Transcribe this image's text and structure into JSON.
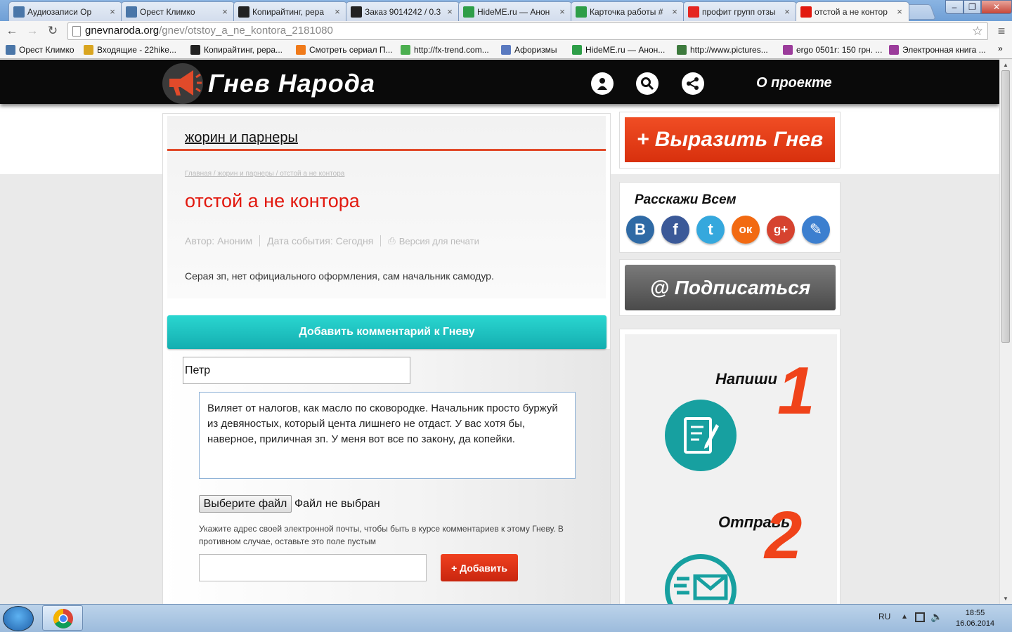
{
  "browser": {
    "tabs": [
      {
        "title": "Аудиозаписи Ор",
        "icon": "play-icon",
        "color": "#4a76a8"
      },
      {
        "title": "Орест Климко",
        "icon": "vk-icon",
        "color": "#4a76a8"
      },
      {
        "title": "Копирайтинг, рера",
        "icon": "a-icon",
        "color": "#222222"
      },
      {
        "title": "Заказ 9014242 / 0.3",
        "icon": "a-icon",
        "color": "#222222"
      },
      {
        "title": "HideME.ru — Анон",
        "icon": "h-icon",
        "color": "#2e9e48"
      },
      {
        "title": "Карточка работы #",
        "icon": "h-icon",
        "color": "#2e9e48"
      },
      {
        "title": "профит групп отзы",
        "icon": "yandex-icon",
        "color": "#e52620"
      },
      {
        "title": "отстой а не контор",
        "icon": "megaphone-icon",
        "color": "#e2190f",
        "active": true
      }
    ],
    "url_domain": "gnevnaroda.org",
    "url_path": "/gnev/otstoy_a_ne_kontora_2181080",
    "bookmarks": [
      {
        "label": "Орест Климко",
        "icon": "vk-icon",
        "color": "#4a76a8"
      },
      {
        "label": "Входящие - 22hike...",
        "icon": "mail-icon",
        "color": "#d9a520"
      },
      {
        "label": "Копирайтинг, рера...",
        "icon": "a-icon",
        "color": "#222222"
      },
      {
        "label": "Смотреть сериал П...",
        "icon": "f-icon",
        "color": "#f07a1a"
      },
      {
        "label": "http://fx-trend.com...",
        "icon": "fx-icon",
        "color": "#4caf50"
      },
      {
        "label": "Афоризмы",
        "icon": "diamond-icon",
        "color": "#5a7ac0"
      },
      {
        "label": "HideME.ru — Анон...",
        "icon": "h-icon",
        "color": "#2e9e48"
      },
      {
        "label": "http://www.pictures...",
        "icon": "picture-icon",
        "color": "#3d7a3d"
      },
      {
        "label": "ergo 0501r: 150 грн. ...",
        "icon": "ergo-icon",
        "color": "#9b3c9b"
      },
      {
        "label": "Электронная книга ...",
        "icon": "book-icon",
        "color": "#9b3c9b"
      }
    ]
  },
  "site": {
    "logo_text": "Гнев Народа",
    "about_label": "О проекте",
    "accent_color": "#e14a2a",
    "teal_color": "#17a0a0"
  },
  "article": {
    "category": "жорин и парнеры",
    "breadcrumb": [
      "Главная",
      "жорин и парнеры",
      "отстой а не контора"
    ],
    "title": "отстой а не контора",
    "author": "Автор: Аноним",
    "event_date": "Дата события: Сегодня",
    "print_label": "Версия для печати",
    "body": "Серая зп, нет официального оформления, сам начальник самодур."
  },
  "comment_form": {
    "header": "Добавить комментарий к Гневу",
    "name_value": "Петр",
    "comment_value": "Виляет от налогов, как масло по сковородке. Начальник просто буржуй из девяностых, который цента лишнего не отдаст. У вас хотя бы, наверное, приличная зп. У меня вот все по закону, да копейки.",
    "file_button": "Выберите файл",
    "file_status": "Файл не выбран",
    "email_hint": "Укажите адрес своей электронной почты, чтобы быть в курсе комментариев к этому Гневу. В противном случае, оставьте это поле пустым",
    "email_value": "",
    "submit_label": "+ Добавить"
  },
  "sidebar": {
    "express_button": "+ Выразить Гнев",
    "share_title": "Расскажи Всем",
    "social": [
      {
        "name": "vk",
        "glyph": "В",
        "color": "#2f6aa5"
      },
      {
        "name": "facebook",
        "glyph": "f",
        "color": "#3b5998"
      },
      {
        "name": "twitter",
        "glyph": "t",
        "color": "#35a8dd"
      },
      {
        "name": "odnoklassniki",
        "glyph": "ок",
        "color": "#f26a12"
      },
      {
        "name": "google-plus",
        "glyph": "g+",
        "color": "#d6432f"
      },
      {
        "name": "livejournal",
        "glyph": "✎",
        "color": "#3c7fcf"
      }
    ],
    "subscribe_button": "@ Подписаться",
    "steps": [
      {
        "word": "Напиши",
        "num": "1"
      },
      {
        "word": "Отправь",
        "num": "2"
      }
    ]
  },
  "taskbar": {
    "lang": "RU",
    "time": "18:55",
    "date": "16.06.2014"
  }
}
